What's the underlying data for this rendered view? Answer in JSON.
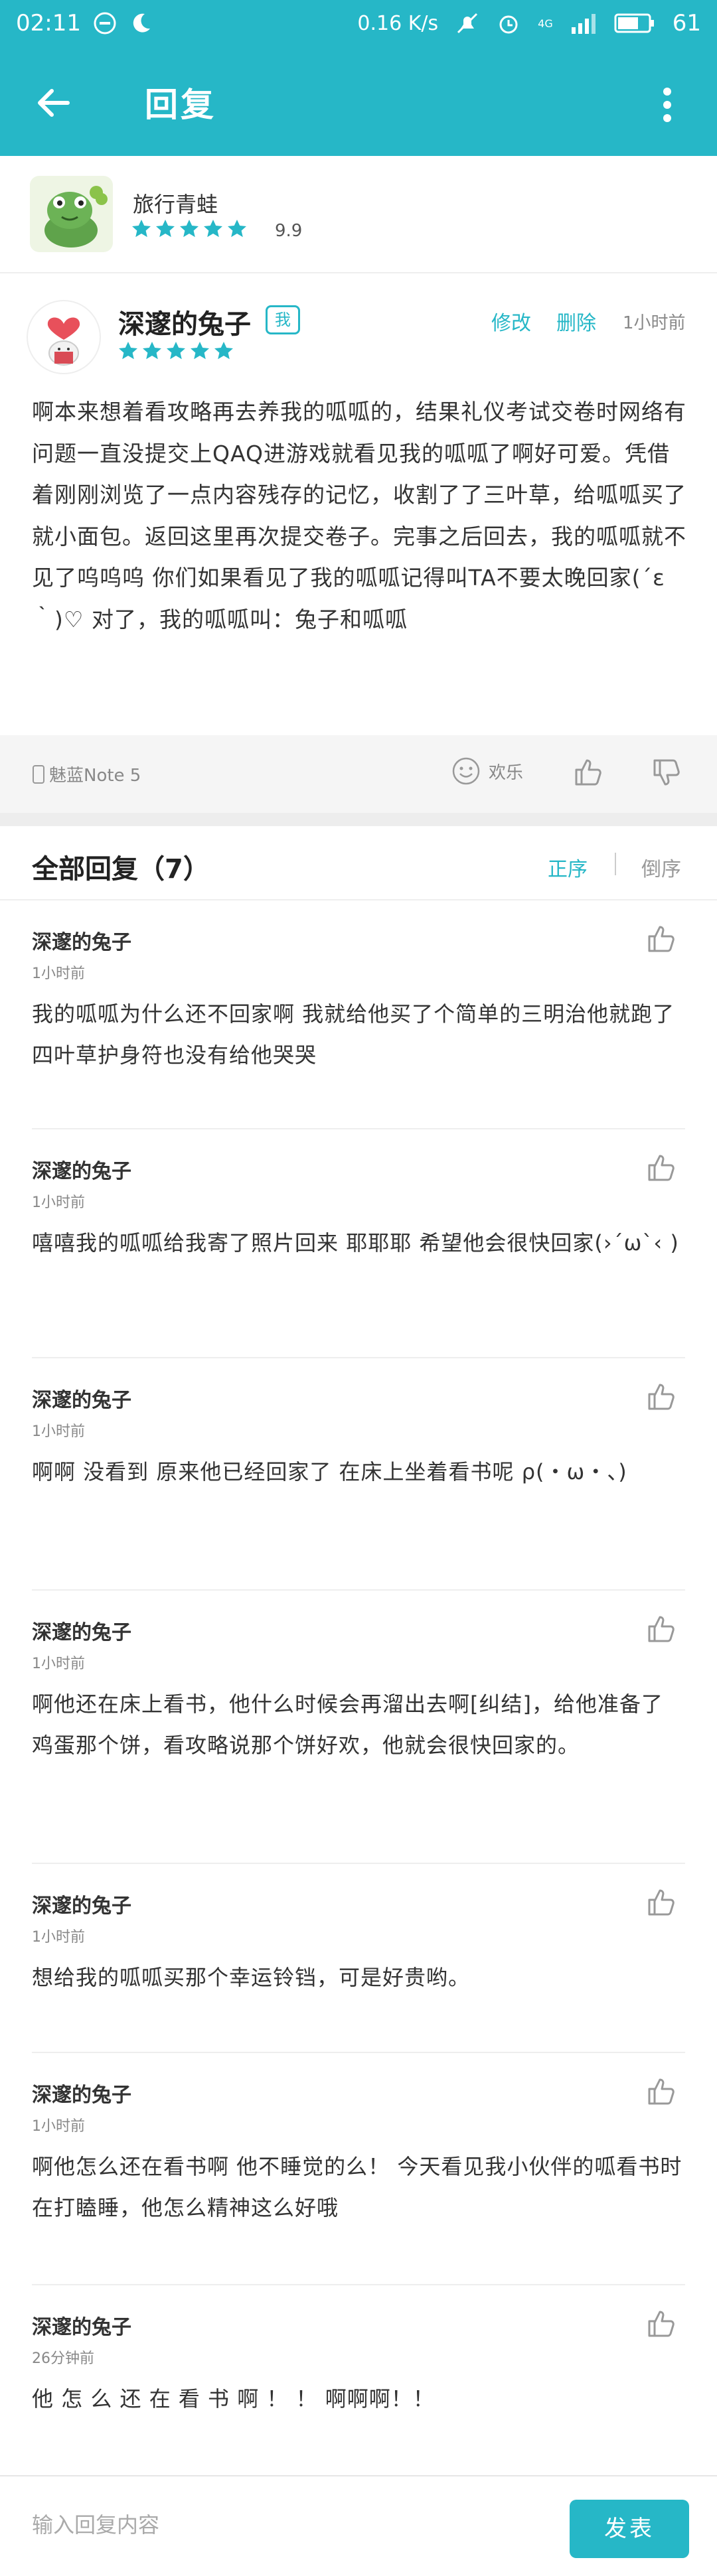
{
  "status_bar": {
    "time": "02:11",
    "net_speed": "0.16 K/s",
    "battery": "61",
    "signal": "4G"
  },
  "appbar": {
    "title": "回复"
  },
  "game": {
    "name": "旅行青蛙",
    "score": "9.9"
  },
  "post": {
    "author": "深邃的兔子",
    "badge": "我",
    "edit": "修改",
    "delete": "删除",
    "time": "1小时前",
    "body": "啊本来想着看攻略再去养我的呱呱的，结果礼仪考试交卷时网络有问题一直没提交上QAQ进游戏就看见我的呱呱了啊好可爱。凭借着刚刚浏览了一点内容残存的记忆，收割了了三叶草，给呱呱买了就小面包。返回这里再次提交卷子。完事之后回去，我的呱呱就不见了呜呜呜 你们如果看见了我的呱呱记得叫TA不要太晚回家(´ε｀)♡ 对了，我的呱呱叫：兔子和呱呱",
    "device": "魅蓝Note 5",
    "mood": "欢乐"
  },
  "replies_header": {
    "title": "全部回复（7）",
    "asc": "正序",
    "desc": "倒序"
  },
  "replies": [
    {
      "user": "深邃的兔子",
      "time": "1小时前",
      "text": "我的呱呱为什么还不回家啊 我就给他买了个简单的三明治他就跑了 四叶草护身符也没有给他哭哭"
    },
    {
      "user": "深邃的兔子",
      "time": "1小时前",
      "text": "嘻嘻我的呱呱给我寄了照片回来 耶耶耶 希望他会很快回家(›´ω`‹ )"
    },
    {
      "user": "深邃的兔子",
      "time": "1小时前",
      "text": "啊啊 没看到 原来他已经回家了 在床上坐着看书呢 ρ(・ω・、)"
    },
    {
      "user": "深邃的兔子",
      "time": "1小时前",
      "text": "啊他还在床上看书，他什么时候会再溜出去啊[纠结]，给他准备了鸡蛋那个饼，看攻略说那个饼好欢，他就会很快回家的。"
    },
    {
      "user": "深邃的兔子",
      "time": "1小时前",
      "text": "想给我的呱呱买那个幸运铃铛，可是好贵哟。"
    },
    {
      "user": "深邃的兔子",
      "time": "1小时前",
      "text": "啊他怎么还在看书啊 他不睡觉的么！ 今天看见我小伙伴的呱看书时在打瞌睡，他怎么精神这么好哦"
    },
    {
      "user": "深邃的兔子",
      "time": "26分钟前",
      "text": "他 怎 么 还 在 看 书 啊 ！ ！  啊啊啊！！"
    }
  ],
  "input": {
    "placeholder": "输入回复内容",
    "send": "发表"
  },
  "colors": {
    "accent": "#26b7c7",
    "star": "#26b7c7"
  }
}
